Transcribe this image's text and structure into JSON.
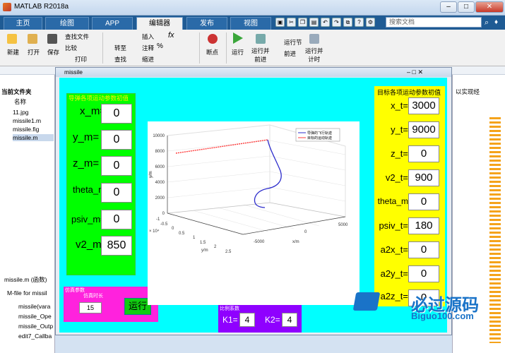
{
  "window": {
    "title": "MATLAB R2018a",
    "close_label": "✕",
    "min_label": "–",
    "max_label": "□"
  },
  "tabs": [
    "主页",
    "绘图",
    "APP",
    "编辑器",
    "发布",
    "视图"
  ],
  "search_placeholder": "搜索文档",
  "toolstrip": {
    "new": "新建",
    "open": "打开",
    "save": "保存",
    "find_files": "查找文件",
    "compare": "比较",
    "print": "打印",
    "insert": "插入",
    "comment": "注释",
    "indent": "缩进",
    "goto": "转至",
    "find": "查找",
    "breakpoints": "断点",
    "run": "运行",
    "run_advance": "运行并\n前进",
    "run_section": "运行节",
    "advance": "前进",
    "run_time": "运行并\n计时"
  },
  "left_panel": {
    "header": "当前文件夹",
    "name_col": "名称",
    "files": [
      "11.jpg",
      "missile1.m",
      "missile.fig",
      "missile.m"
    ],
    "details_title": "missile.m  (函数)",
    "details_text": "M-file for missil",
    "functions": [
      "missile(vara",
      "missile_Ope",
      "missile_Outp",
      "edit7_Callba"
    ]
  },
  "right_panel": {
    "text": "以实现经"
  },
  "figure": {
    "title": "missile",
    "missile_panel": {
      "title": "导弹各项运动参数初值",
      "fields": [
        {
          "label": "x_m=",
          "value": "0"
        },
        {
          "label": "y_m=",
          "value": "0"
        },
        {
          "label": "z_m=",
          "value": "0"
        },
        {
          "label": "theta_m=",
          "value": "0"
        },
        {
          "label": "psiv_m=",
          "value": "0"
        },
        {
          "label": "v2_m=",
          "value": "850"
        }
      ]
    },
    "target_panel": {
      "title": "目标各项运动参数初值",
      "fields": [
        {
          "label": "x_t=",
          "value": "3000"
        },
        {
          "label": "y_t=",
          "value": "9000"
        },
        {
          "label": "z_t=",
          "value": "0"
        },
        {
          "label": "v2_t=",
          "value": "900"
        },
        {
          "label": "theta_m",
          "value": "0"
        },
        {
          "label": "psiv_t=",
          "value": "180"
        },
        {
          "label": "a2x_t=",
          "value": "0"
        },
        {
          "label": "a2y_t=",
          "value": "0"
        },
        {
          "label": "a2z_t=",
          "value": "0"
        }
      ]
    },
    "sim_panel": {
      "title": "仿真参数",
      "sub_label": "仿真时长",
      "value": "15",
      "run_label": "运行"
    },
    "gain_panel": {
      "title": "比例系数",
      "k1_label": "K1=",
      "k1": "4",
      "k2_label": "K2=",
      "k2": "4"
    },
    "plot": {
      "legend": [
        "导弹的飞行轨迹",
        "目标的运动轨迹"
      ],
      "z_ticks": [
        "0",
        "2000",
        "4000",
        "6000",
        "8000",
        "10000"
      ],
      "x_ticks": [
        "-5000",
        "0",
        "5000"
      ],
      "y_ticks": [
        "-1",
        "-0.5",
        "0",
        "0.5",
        "1",
        "1.5",
        "2",
        "2.5"
      ],
      "y_exponent": "× 10⁴",
      "x_label": "x/m",
      "y_label": "y/m",
      "z_label": "y/m",
      "colors": {
        "missile": "#2d2dcc",
        "target": "#ff3b3b"
      }
    }
  },
  "watermark": {
    "text": "必过源码",
    "url": "Biguo100.com"
  }
}
